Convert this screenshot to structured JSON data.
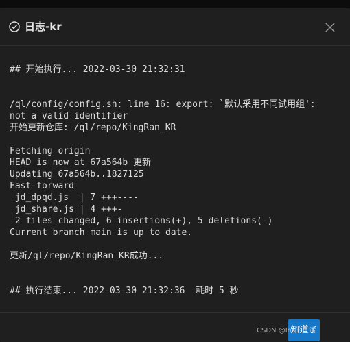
{
  "dialog": {
    "title": "日志-kr",
    "close_icon": "close-icon",
    "title_icon": "check-circle-icon",
    "ok_label": "知道了"
  },
  "log": {
    "lines": [
      "## 开始执行... 2022-03-30 21:32:31",
      "/ql/config/config.sh: line 16: export: `默认采用不同试用组':",
      "not a valid identifier",
      "开始更新仓库: /ql/repo/KingRan_KR",
      "Fetching origin",
      "HEAD is now at 67a564b 更新",
      "Updating 67a564b..1827125",
      "Fast-forward",
      " jd_dpqd.js  | 7 +++----",
      " jd_share.js | 4 +++-",
      " 2 files changed, 6 insertions(+), 5 deletions(-)",
      "Current branch main is up to date.",
      "更新/ql/repo/KingRan_KR成功...",
      "## 执行结束... 2022-03-30 21:32:36  耗时 5 秒"
    ]
  },
  "watermark": "CSDN @Ins的生活"
}
